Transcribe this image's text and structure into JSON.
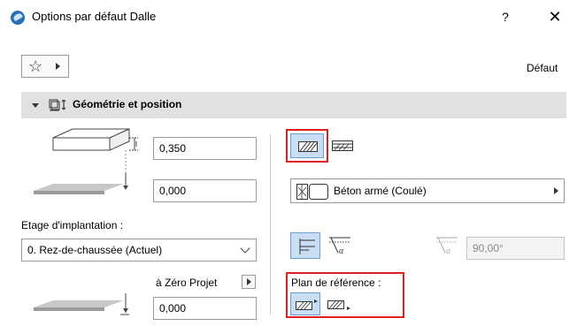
{
  "window": {
    "title": "Options par défaut Dalle",
    "help_label": "?",
    "close_label": "✕"
  },
  "toolbar": {
    "favorites_icon": "star-icon",
    "default_label": "Défaut"
  },
  "section": {
    "title": "Géométrie et position",
    "icon": "geometry-position-icon"
  },
  "geometry": {
    "thickness_value": "0,350",
    "offset_value": "0,000",
    "story_label": "Etage d'implantation :",
    "story_value": "0. Rez-de-chaussée (Actuel)",
    "project_zero_label": "à Zéro Projet",
    "project_zero_value": "0,000"
  },
  "structure": {
    "material_value": "Béton armé (Coulé)",
    "angle_value": "90,00°",
    "reference_plane_label": "Plan de référence :"
  },
  "colors": {
    "highlight": "#e02020",
    "toggle_on": "#c9def4",
    "section_bg": "#e1e1e1"
  }
}
